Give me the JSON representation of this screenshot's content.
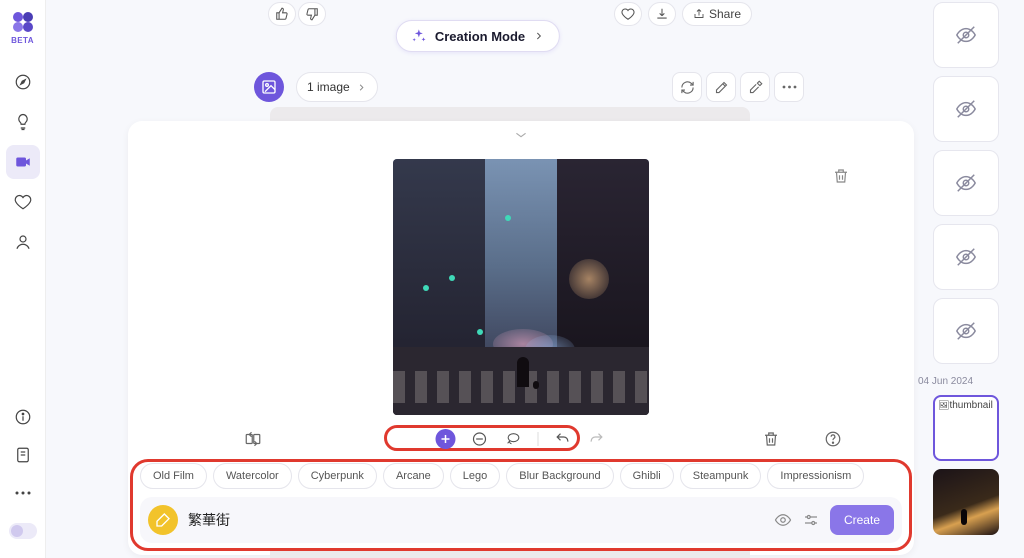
{
  "meta": {
    "beta_label": "BETA"
  },
  "top": {
    "share_label": "Share"
  },
  "mode": {
    "label": "Creation Mode"
  },
  "image_head": {
    "count_label": "1 image"
  },
  "gallery": {
    "date_label": "04 Jun 2024",
    "active_alt": "thumbnail"
  },
  "styles": [
    "Old Film",
    "Watercolor",
    "Cyberpunk",
    "Arcane",
    "Lego",
    "Blur Background",
    "Ghibli",
    "Steampunk",
    "Impressionism"
  ],
  "prompt": {
    "value": "繁華街",
    "create_label": "Create"
  }
}
